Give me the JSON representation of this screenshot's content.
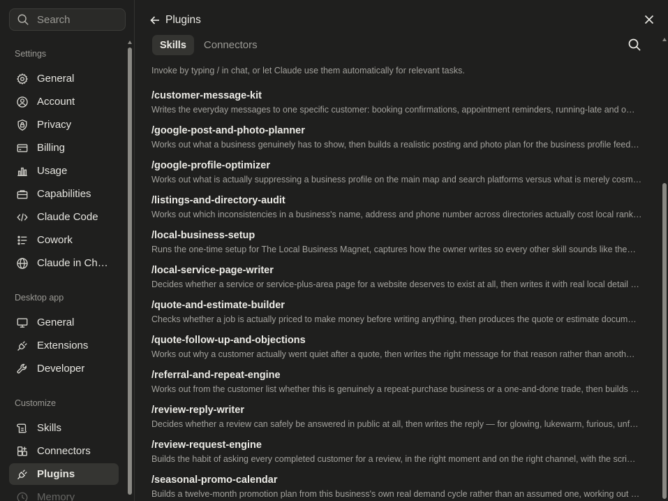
{
  "sidebar": {
    "search": {
      "placeholder": "Search"
    },
    "sections": [
      {
        "label": "Settings"
      },
      {
        "label": "Desktop app"
      },
      {
        "label": "Customize"
      }
    ],
    "settings_items": [
      {
        "label": "General",
        "icon": "gear-icon"
      },
      {
        "label": "Account",
        "icon": "user-circle-icon"
      },
      {
        "label": "Privacy",
        "icon": "shield-lock-icon"
      },
      {
        "label": "Billing",
        "icon": "credit-card-icon"
      },
      {
        "label": "Usage",
        "icon": "bar-chart-icon"
      },
      {
        "label": "Capabilities",
        "icon": "briefcase-icon"
      },
      {
        "label": "Claude Code",
        "icon": "code-icon"
      },
      {
        "label": "Cowork",
        "icon": "checklist-icon"
      },
      {
        "label": "Claude in Chr…",
        "icon": "globe-icon"
      }
    ],
    "desktop_items": [
      {
        "label": "General",
        "icon": "monitor-icon"
      },
      {
        "label": "Extensions",
        "icon": "plug-icon"
      },
      {
        "label": "Developer",
        "icon": "wrench-icon"
      }
    ],
    "customize_items": [
      {
        "label": "Skills",
        "icon": "skills-icon"
      },
      {
        "label": "Connectors",
        "icon": "grid-plus-icon"
      },
      {
        "label": "Plugins",
        "icon": "plug-icon",
        "active": true
      },
      {
        "label": "Memory",
        "icon": "memory-icon"
      }
    ]
  },
  "header": {
    "title": "Plugins"
  },
  "tabs": [
    {
      "label": "Skills",
      "active": true
    },
    {
      "label": "Connectors",
      "active": false
    }
  ],
  "intro": "Invoke by typing / in chat, or let Claude use them automatically for relevant tasks.",
  "skills": [
    {
      "name": "/customer-message-kit",
      "desc": "Writes the everyday messages to one specific customer: booking confirmations, appointment reminders, running-late and o…"
    },
    {
      "name": "/google-post-and-photo-planner",
      "desc": "Works out what a business genuinely has to show, then builds a realistic posting and photo plan for the business profile feed…"
    },
    {
      "name": "/google-profile-optimizer",
      "desc": "Works out what is actually suppressing a business profile on the main map and search platforms versus what is merely cosm…"
    },
    {
      "name": "/listings-and-directory-audit",
      "desc": "Works out which inconsistencies in a business's name, address and phone number across directories actually cost local rank…"
    },
    {
      "name": "/local-business-setup",
      "desc": "Runs the one-time setup for The Local Business Magnet, captures how the owner writes so every other skill sounds like the…"
    },
    {
      "name": "/local-service-page-writer",
      "desc": "Decides whether a service or service-plus-area page for a website deserves to exist at all, then writes it with real local detail …"
    },
    {
      "name": "/quote-and-estimate-builder",
      "desc": "Checks whether a job is actually priced to make money before writing anything, then produces the quote or estimate docum…"
    },
    {
      "name": "/quote-follow-up-and-objections",
      "desc": "Works out why a customer actually went quiet after a quote, then writes the right message for that reason rather than anoth…"
    },
    {
      "name": "/referral-and-repeat-engine",
      "desc": "Works out from the customer list whether this is genuinely a repeat-purchase business or a one-and-done trade, then builds …"
    },
    {
      "name": "/review-reply-writer",
      "desc": "Decides whether a review can safely be answered in public at all, then writes the reply — for glowing, lukewarm, furious, unf…"
    },
    {
      "name": "/review-request-engine",
      "desc": "Builds the habit of asking every completed customer for a review, in the right moment and on the right channel, with the scri…"
    },
    {
      "name": "/seasonal-promo-calendar",
      "desc": "Builds a twelve-month promotion plan from this business's own real demand cycle rather than an assumed one, working out …"
    }
  ]
}
